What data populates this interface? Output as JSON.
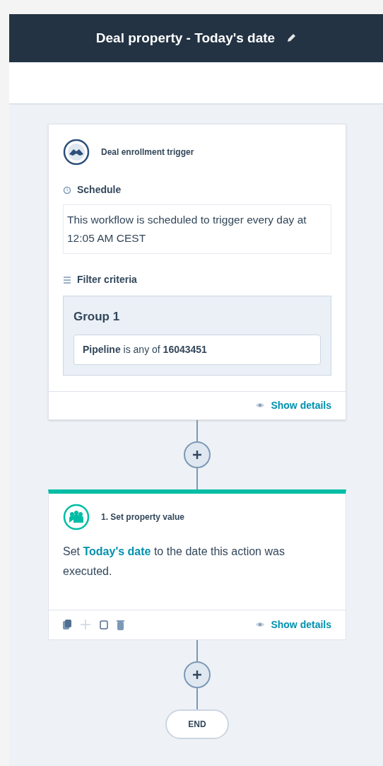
{
  "header": {
    "title": "Deal property - Today's date"
  },
  "trigger": {
    "title": "Deal enrollment trigger",
    "schedule_label": "Schedule",
    "schedule_text": "This workflow is scheduled to trigger every day at 12:05 AM CEST",
    "filter_label": "Filter criteria",
    "group_title": "Group 1",
    "filter": "**Pipeline** is any of **16043451**",
    "details_link": "Show details"
  },
  "action": {
    "title": "1. Set property value",
    "text_before": "Set",
    "link": "Today's date",
    "text_after": "to the date this action was executed.",
    "details_link": "Show details"
  },
  "end": {
    "label": "END"
  }
}
